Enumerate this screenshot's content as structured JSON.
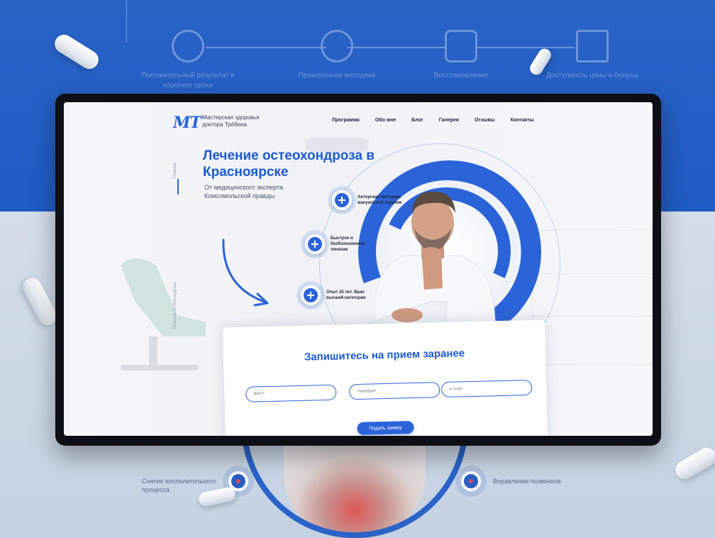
{
  "logo": {
    "mark": "MT",
    "text": "Мастерская здоровья доктора Трёбина"
  },
  "nav": [
    "Программа",
    "Обо мне",
    "Блог",
    "Галерея",
    "Отзывы",
    "Контакты"
  ],
  "side": {
    "top_label": "Главная",
    "bottom_label": "Лечение остеохондроза"
  },
  "hero": {
    "title": "Лечение остеохондроза в Красноярске",
    "subtitle": "От медицинского эксперта Комсомольской правды"
  },
  "features": [
    {
      "icon": "plus-icon",
      "text": "Авторская методика мануальной терапии"
    },
    {
      "icon": "plus-icon",
      "text": "Быстрое и безболезненное лечение"
    },
    {
      "icon": "plus-icon",
      "text": "Опыт 25 лет. Врач высшей категории"
    }
  ],
  "form": {
    "title": "Запишитесь на прием заранее",
    "name_placeholder": "ФИО*",
    "phone_placeholder": "Телефон*",
    "email_placeholder": "E-mail*",
    "submit_label": "Подать заявку"
  },
  "background": {
    "steps": [
      "Положительный результат и короткие сроки",
      "Проверенная методика",
      "Восстановление",
      "Доступность цены и бонусы"
    ],
    "bottom_left": "Снятие воспалительного процесса",
    "bottom_right": "Вправление позвонков"
  },
  "colors": {
    "accent": "#2b63d8",
    "backdrop_top": "#2a63c6",
    "backdrop_bottom": "#c9d6e6"
  }
}
